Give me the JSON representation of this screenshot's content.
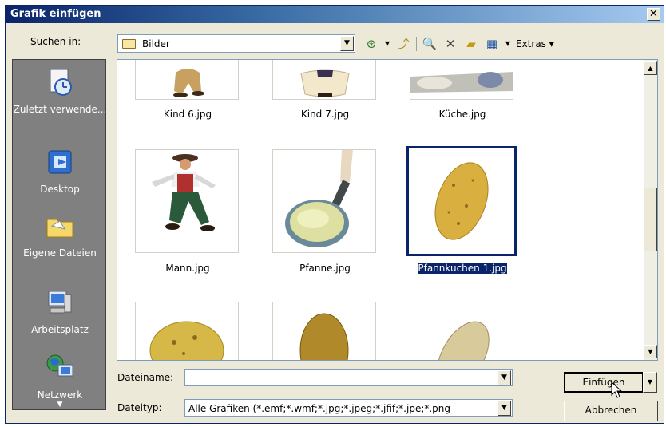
{
  "window": {
    "title": "Grafik einfügen",
    "close_glyph": "✕"
  },
  "lookin": {
    "label": "Suchen in:",
    "value": "Bilder"
  },
  "toolbar": {
    "extras_label": "Extras"
  },
  "places": [
    {
      "label": "Zuletzt verwende...",
      "icon": "recent-icon"
    },
    {
      "label": "Desktop",
      "icon": "desktop-icon"
    },
    {
      "label": "Eigene Dateien",
      "icon": "my-documents-icon"
    },
    {
      "label": "Arbeitsplatz",
      "icon": "my-computer-icon"
    },
    {
      "label": "Netzwerk",
      "icon": "network-icon"
    }
  ],
  "files": [
    {
      "name": "Kind 6.jpg",
      "selected": false
    },
    {
      "name": "Kind 7.jpg",
      "selected": false
    },
    {
      "name": "Küche.jpg",
      "selected": false
    },
    {
      "name": "Mann.jpg",
      "selected": false
    },
    {
      "name": "Pfanne.jpg",
      "selected": false
    },
    {
      "name": "Pfannkuchen 1.jpg",
      "selected": true
    }
  ],
  "filename": {
    "label": "Dateiname:",
    "value": ""
  },
  "filetype": {
    "label": "Dateityp:",
    "value": "Alle Grafiken (*.emf;*.wmf;*.jpg;*.jpeg;*.jfif;*.jpe;*.png"
  },
  "buttons": {
    "insert": "Einfügen",
    "cancel": "Abbrechen"
  },
  "colors": {
    "title_bar": "#0a246a",
    "selection": "#0a246a",
    "places_bg": "#808080"
  }
}
